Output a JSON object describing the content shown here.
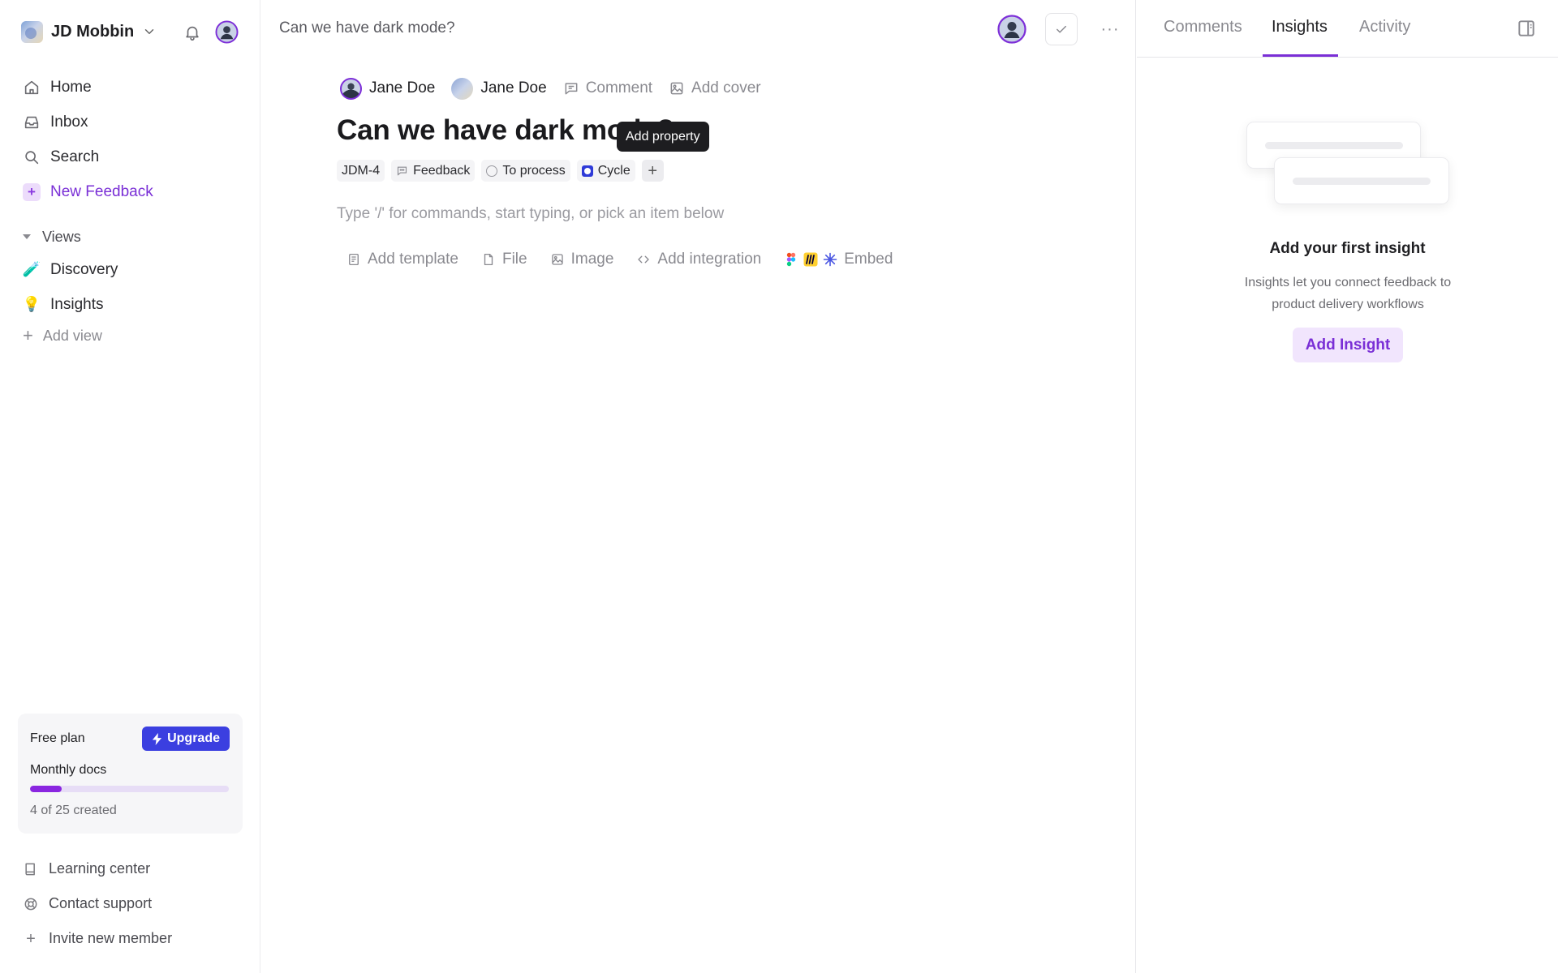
{
  "workspace": {
    "name": "JD Mobbin"
  },
  "nav": {
    "home": "Home",
    "inbox": "Inbox",
    "search": "Search",
    "new_feedback": "New Feedback"
  },
  "views": {
    "header": "Views",
    "items": [
      {
        "label": "Discovery",
        "emoji": "🧪"
      },
      {
        "label": "Insights",
        "emoji": "💡"
      }
    ],
    "add_view": "Add view"
  },
  "plan": {
    "label": "Free plan",
    "upgrade_label": "Upgrade",
    "docs_label": "Monthly docs",
    "docs_count": "4 of 25 created",
    "docs_used": 4,
    "docs_total": 25,
    "accent": "#8a26e0"
  },
  "footer": {
    "learning": "Learning center",
    "support": "Contact support",
    "invite": "Invite new member"
  },
  "header": {
    "breadcrumb": "Can we have dark mode?",
    "more": "···"
  },
  "doc": {
    "owner": "Jane Doe",
    "assignee": "Jane Doe",
    "comment": "Comment",
    "add_cover": "Add cover",
    "title": "Can we have dark mode?",
    "props": {
      "id": "JDM-4",
      "type": "Feedback",
      "status": "To process",
      "cycle": "Cycle"
    },
    "tooltip": "Add property",
    "hint": "Type '/' for commands, start typing, or pick an item below",
    "toolbar": {
      "template": "Add template",
      "file": "File",
      "image": "Image",
      "integration": "Add integration",
      "embed": "Embed"
    }
  },
  "panel": {
    "tabs": {
      "comments": "Comments",
      "insights": "Insights",
      "activity": "Activity"
    },
    "active_tab": "Insights",
    "empty_title": "Add your first insight",
    "empty_desc": "Insights let you connect feedback to product delivery workflows",
    "add_insight": "Add Insight"
  },
  "colors": {
    "brand": "#7a2fd6",
    "upgrade": "#3b3fe0",
    "tooltip_bg": "#1d1d20"
  }
}
